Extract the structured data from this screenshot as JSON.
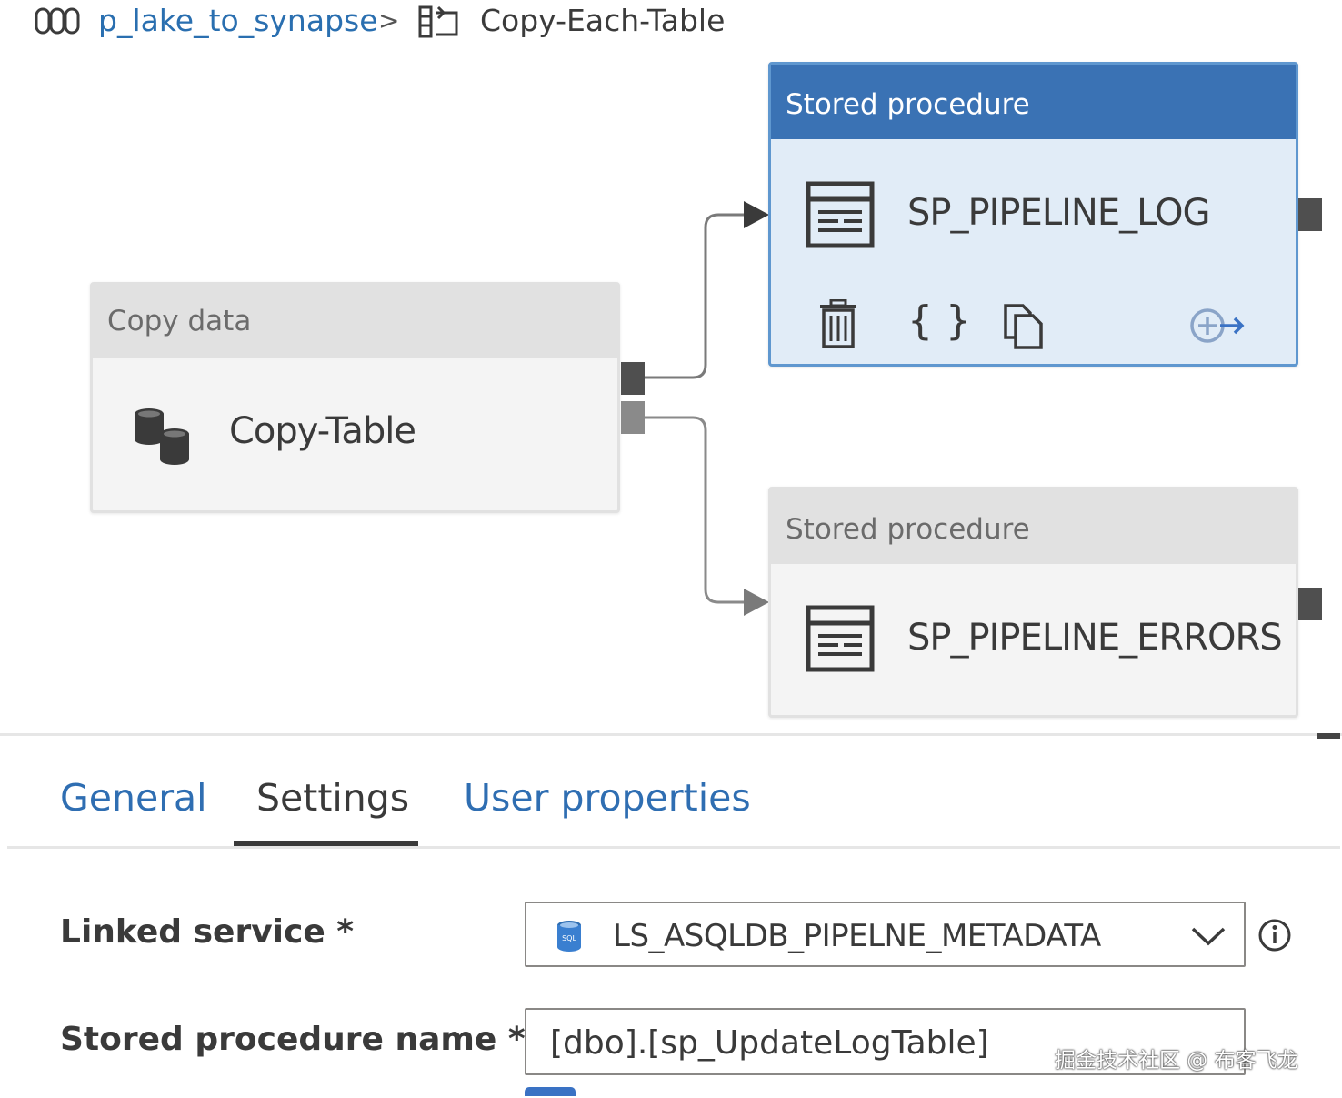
{
  "breadcrumb": {
    "pipeline_icon": "pipeline-icon",
    "pipeline": "p_lake_to_synapse",
    "separator": ">",
    "activity_icon": "foreach-icon",
    "activity": "Copy-Each-Table"
  },
  "canvas": {
    "copy_activity": {
      "type": "Copy data",
      "name": "Copy-Table",
      "icon": "database-copy-icon"
    },
    "sp_log": {
      "type": "Stored procedure",
      "name": "SP_PIPELINE_LOG",
      "icon": "stored-procedure-icon",
      "selected": true,
      "actions": [
        "delete-icon",
        "code-icon",
        "clone-icon",
        "add-output-icon"
      ]
    },
    "sp_errors": {
      "type": "Stored procedure",
      "name": "SP_PIPELINE_ERRORS",
      "icon": "stored-procedure-icon"
    }
  },
  "tabs": {
    "general": "General",
    "settings": "Settings",
    "user_properties": "User properties",
    "active": "Settings"
  },
  "form": {
    "linked_service": {
      "label": "Linked service *",
      "value": "LS_ASQLDB_PIPELNE_METADATA",
      "icon": "sql-database-icon"
    },
    "stored_procedure": {
      "label": "Stored procedure name *",
      "value": "[dbo].[sp_UpdateLogTable]"
    }
  },
  "watermark": "掘金技术社区 @ 布客飞龙",
  "colors": {
    "selected_header": "#3a72b4",
    "selected_body": "#e1ecf7",
    "link": "#2f6eb2",
    "port": "#4f4f4f"
  }
}
